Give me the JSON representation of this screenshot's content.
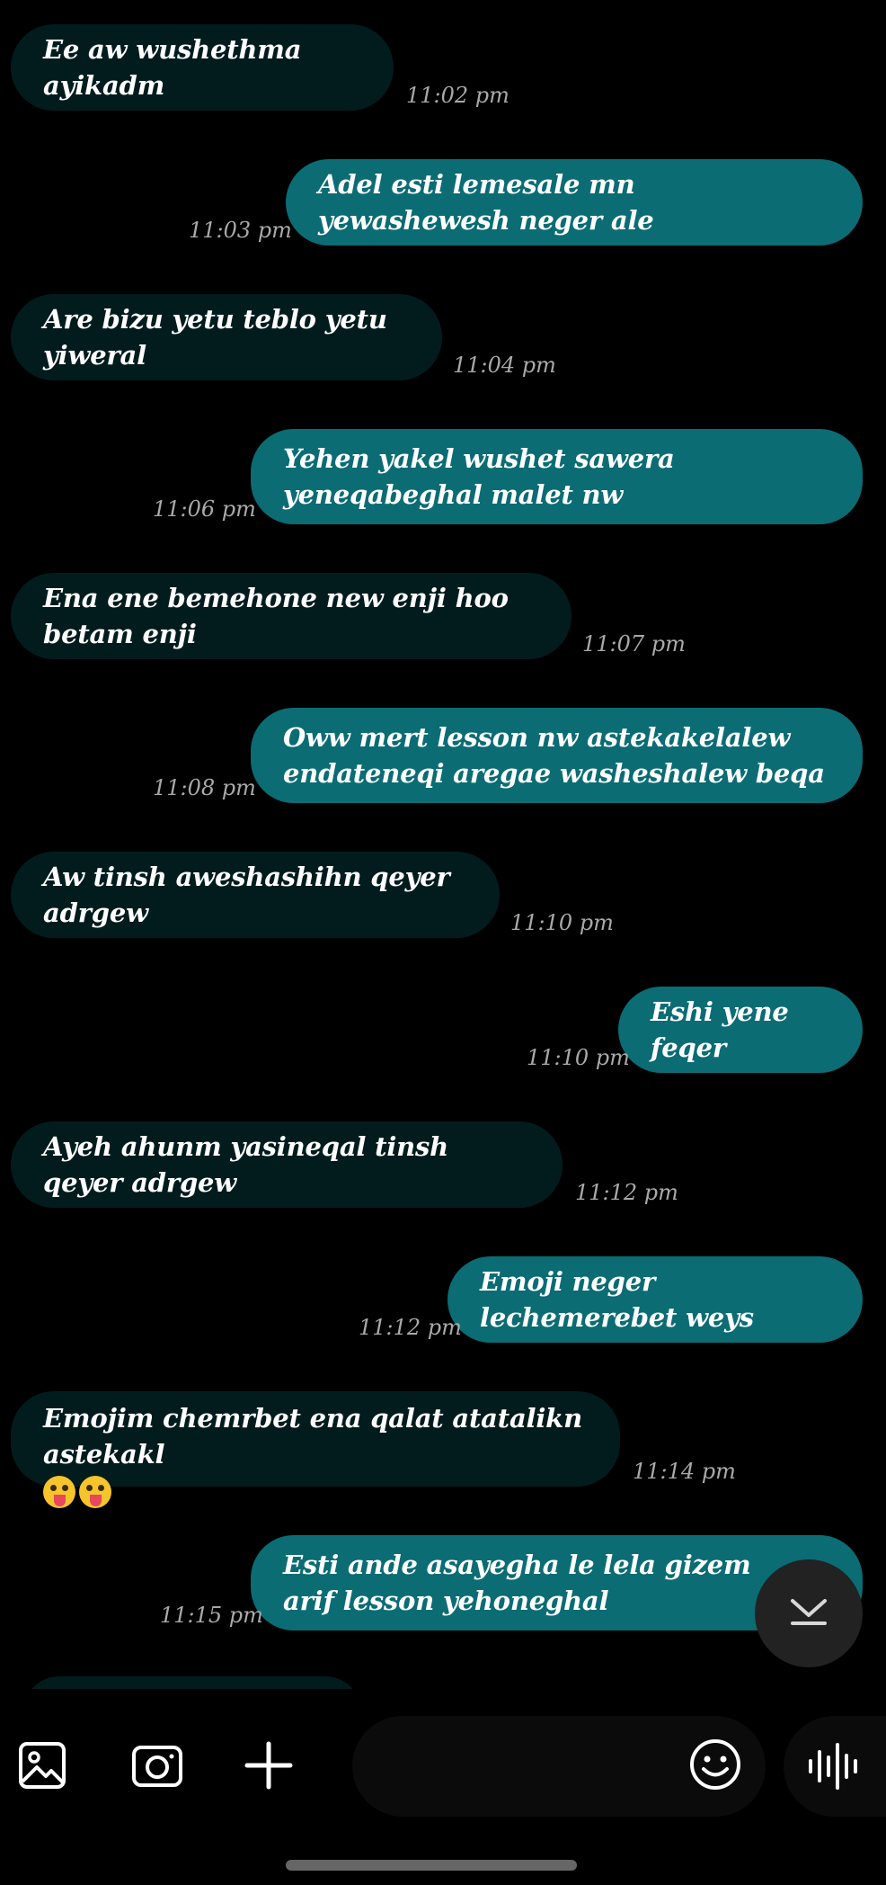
{
  "messages": [
    {
      "direction": "incoming",
      "text": "Ee aw wushethma ayikadm",
      "time": "11:02 pm"
    },
    {
      "direction": "outgoing",
      "text": "Adel esti lemesale mn yewashewesh neger ale",
      "time": "11:03 pm"
    },
    {
      "direction": "incoming",
      "text": "Are bizu yetu teblo yetu yiweral",
      "time": "11:04 pm"
    },
    {
      "direction": "outgoing",
      "text": "Yehen yakel wushet sawera yeneqabeghal malet nw",
      "time": "11:06 pm"
    },
    {
      "direction": "incoming",
      "text": "Ena ene bemehone new enji hoo betam enji",
      "time": "11:07 pm"
    },
    {
      "direction": "outgoing",
      "text": "Oww mert lesson nw astekakelalew endateneqi aregae washeshalew beqa",
      "time": "11:08 pm"
    },
    {
      "direction": "incoming",
      "text": "Aw tinsh aweshashihn qeyer adrgew",
      "time": "11:10 pm"
    },
    {
      "direction": "outgoing",
      "text": "Eshi yene feqer",
      "time": "11:10 pm"
    },
    {
      "direction": "incoming",
      "text": "Ayeh ahunm yasineqal tinsh qeyer adrgew",
      "time": "11:12 pm"
    },
    {
      "direction": "outgoing",
      "text": "Emoji neger lechemerebet weys",
      "time": "11:12 pm"
    },
    {
      "direction": "incoming",
      "text": "Emojim chemrbet ena qalat atatalikn astekakl",
      "time": "11:14 pm",
      "emoji": "zany-face-emoji",
      "emoji_count": 2
    },
    {
      "direction": "outgoing",
      "text": "Esti ande asayegha le lela gizem arif lesson yehoneghal",
      "time": "11:15 pm"
    }
  ],
  "composer": {
    "placeholder": ""
  },
  "icons": {
    "gallery": "image-icon",
    "camera": "camera-icon",
    "add": "plus-icon",
    "emoji": "smiley-icon",
    "voice": "waveform-icon",
    "scroll_down": "chevron-down-icon"
  },
  "colors": {
    "background": "#000000",
    "incoming_bubble": "#021c1e",
    "outgoing_bubble": "#0b6c74",
    "timestamp": "#a9a9a9",
    "icon": "#ffffff"
  }
}
